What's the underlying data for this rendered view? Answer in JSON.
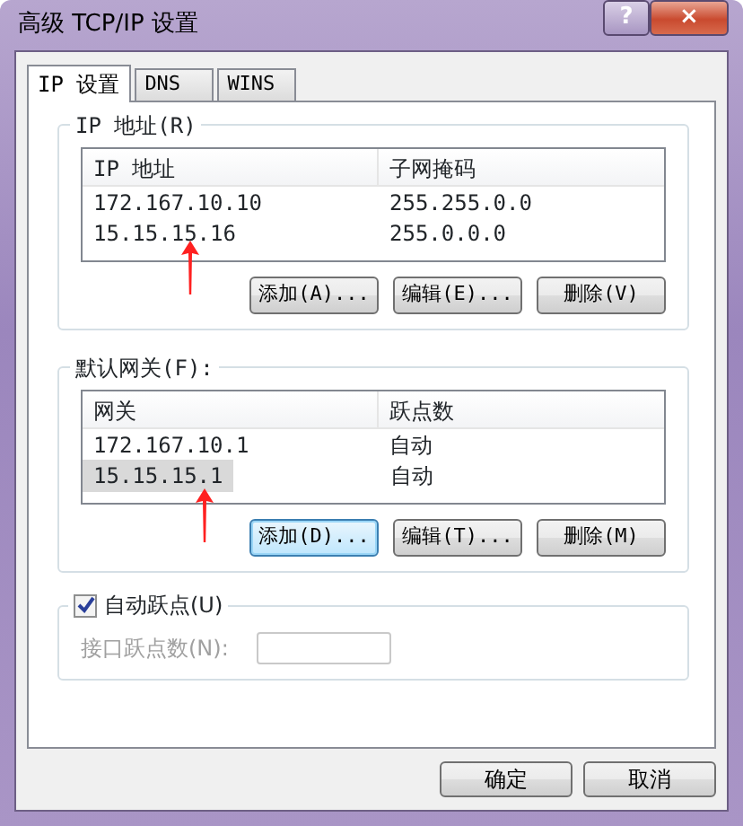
{
  "window": {
    "title": "高级 TCP/IP 设置",
    "help_button": "?",
    "close_button": "×"
  },
  "tabs": [
    {
      "label": "IP 设置",
      "selected": true
    },
    {
      "label": "DNS",
      "selected": false
    },
    {
      "label": "WINS",
      "selected": false
    }
  ],
  "ip_addresses": {
    "legend": "IP 地址(R)",
    "columns": [
      "IP 地址",
      "子网掩码"
    ],
    "rows": [
      {
        "cells": [
          "172.167.10.10",
          "255.255.0.0"
        ],
        "selected": false
      },
      {
        "cells": [
          "15.15.15.16",
          "255.0.0.0"
        ],
        "selected": false
      }
    ],
    "buttons": [
      {
        "label": "添加(A)...",
        "focused": false
      },
      {
        "label": "编辑(E)...",
        "focused": false
      },
      {
        "label": "删除(V)",
        "focused": false
      }
    ]
  },
  "gateways": {
    "legend": "默认网关(F):",
    "columns": [
      "网关",
      "跃点数"
    ],
    "rows": [
      {
        "cells": [
          "172.167.10.1",
          "自动"
        ],
        "selected": false
      },
      {
        "cells": [
          "15.15.15.1",
          "自动"
        ],
        "selected": true
      }
    ],
    "buttons": [
      {
        "label": "添加(D)...",
        "focused": true
      },
      {
        "label": "编辑(T)...",
        "focused": false
      },
      {
        "label": "删除(M)",
        "focused": false
      }
    ]
  },
  "auto_metric": {
    "label": "自动跃点(U)",
    "checked": true,
    "field_label": "接口跃点数(N):",
    "field_disabled": true
  },
  "footer_buttons": [
    "确定",
    "取消"
  ]
}
